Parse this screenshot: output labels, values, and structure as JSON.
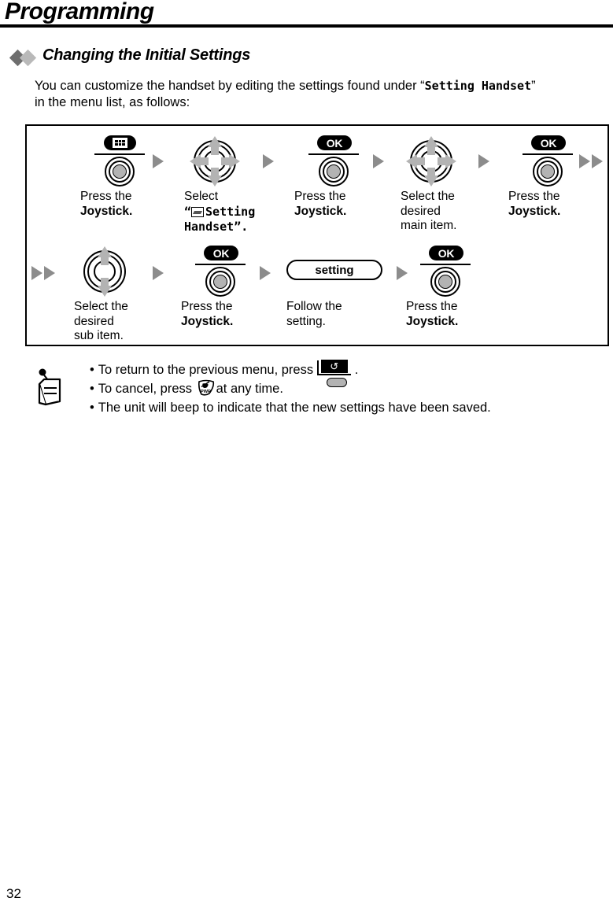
{
  "header": {
    "title": "Programming"
  },
  "section": {
    "title": "Changing the Initial Settings",
    "bullet_dark_color": "#6e6e6e",
    "bullet_light_color": "#b9b9b9"
  },
  "intro": {
    "line1_prefix": "You can customize the handset by editing the settings found under “",
    "line1_mono": "Setting Handset",
    "line1_suffix": "”",
    "line2": "in the menu list, as follows:"
  },
  "flow": {
    "row1": [
      {
        "icon": "menu-key",
        "badge_label": "",
        "label_line1": "Press the",
        "label_line2": "Joystick.",
        "label_bold2": true
      },
      {
        "icon": "nav-4way",
        "label_line1": "Select",
        "label_line2_quote_open": "“",
        "label_line2_mono": "Setting",
        "label_line3_mono": "Handset",
        "label_line3_suffix": "”."
      },
      {
        "icon": "ok-key",
        "badge_label": "OK",
        "label_line1": "Press the",
        "label_line2": "Joystick.",
        "label_bold2": true
      },
      {
        "icon": "nav-4way",
        "label_line1": "Select the",
        "label_line2": "desired",
        "label_line3": "main item."
      },
      {
        "icon": "ok-key",
        "badge_label": "OK",
        "label_line1": "Press the",
        "label_line2": "Joystick.",
        "label_bold2": true
      }
    ],
    "row2": [
      {
        "icon": "nav-2way",
        "label_line1": "Select the",
        "label_line2": "desired",
        "label_line3": "sub item."
      },
      {
        "icon": "ok-key",
        "badge_label": "OK",
        "label_line1": "Press the",
        "label_line2": "Joystick.",
        "label_bold2": true
      },
      {
        "icon": "setting-pill",
        "pill_label": "setting",
        "label_line1": "Follow the",
        "label_line2": "setting."
      },
      {
        "icon": "ok-key",
        "badge_label": "OK",
        "label_line1": "Press the",
        "label_line2": "Joystick.",
        "label_bold2": true
      }
    ],
    "separator_glyph": "▶",
    "continue_glyph": "▶▶",
    "separator_color": "#8c8c8c"
  },
  "note": {
    "bullet": "•",
    "item1_before": "To return to the previous menu, press",
    "item1_after": ".",
    "item1_icon_glyph": "↺",
    "item2_before": "To cancel, press",
    "item2_after": "at any time.",
    "item2_icon_label": "PWR",
    "item3": "The unit will beep to indicate that the new settings have been saved."
  },
  "footer": {
    "page_number": "32"
  }
}
